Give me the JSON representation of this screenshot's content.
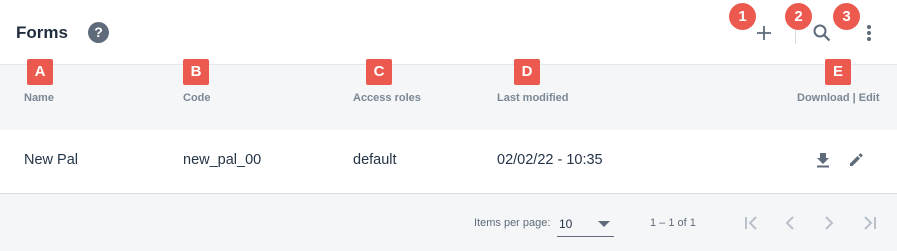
{
  "header": {
    "title": "Forms",
    "help_glyph": "?",
    "icons": [
      "help-icon",
      "add-icon",
      "search-icon",
      "more-vert-icon"
    ]
  },
  "callouts": {
    "numbers": [
      "1",
      "2",
      "3"
    ],
    "letters": [
      "A",
      "B",
      "C",
      "D",
      "E"
    ],
    "color": "#ec5a4f"
  },
  "table": {
    "columns": [
      "Name",
      "Code",
      "Access roles",
      "Last modified",
      "Download | Edit"
    ],
    "rows": [
      {
        "name": "New Pal",
        "code": "new_pal_00",
        "access_roles": "default",
        "last_modified": "02/02/22 - 10:35",
        "actions": [
          "download-icon",
          "edit-icon"
        ]
      }
    ]
  },
  "paginator": {
    "items_per_page_label": "Items per page:",
    "items_per_page_value": "10",
    "range_label": "1 – 1 of 1",
    "buttons": [
      "first-page-icon",
      "previous-page-icon",
      "next-page-icon",
      "last-page-icon"
    ]
  },
  "colors": {
    "badge": "#ec5a4f",
    "header_bg": "#f4f6f8",
    "text": "#243447",
    "muted": "#7b8794"
  }
}
